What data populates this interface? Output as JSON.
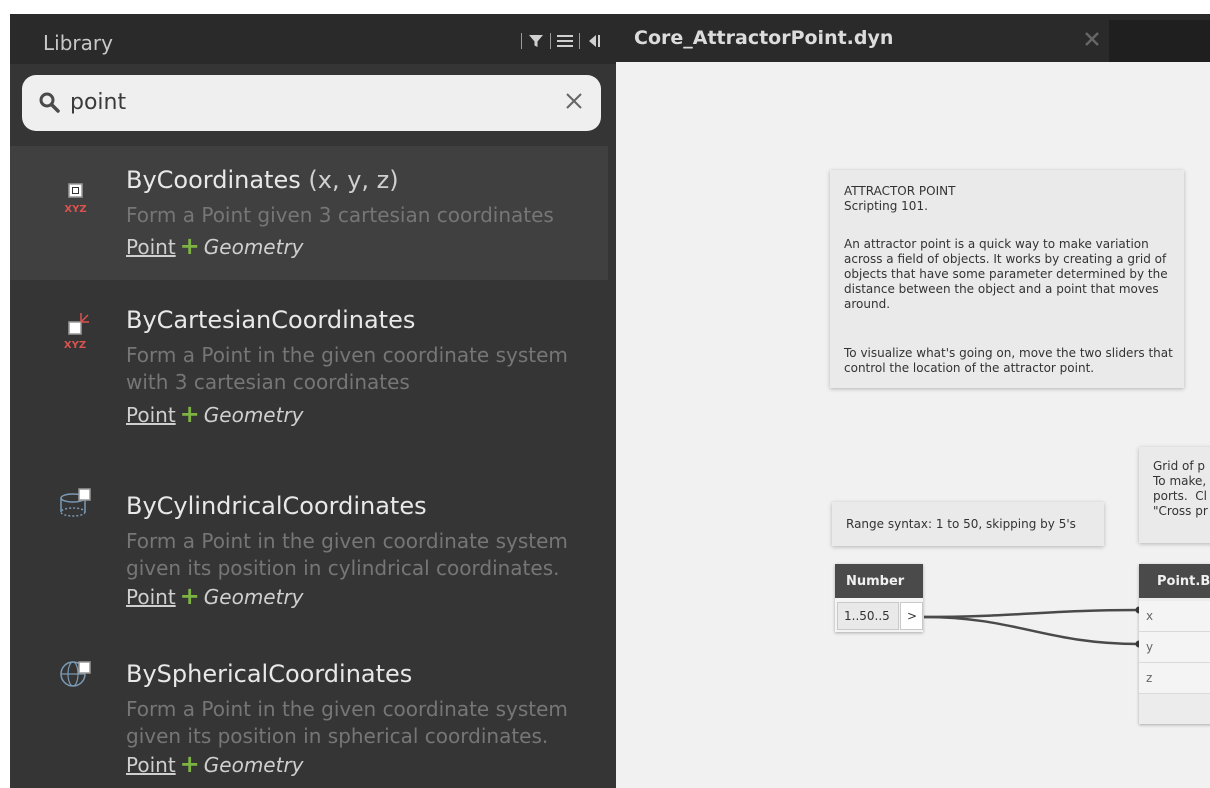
{
  "library": {
    "title": "Library",
    "search": {
      "value": "point",
      "placeholder": ""
    },
    "items": [
      {
        "name": "ByCoordinates",
        "params": " (x, y, z)",
        "description": "Form a Point given 3 cartesian coordinates",
        "category": "Point",
        "group": "Geometry",
        "icon": "point-by-coordinates-icon",
        "selected": true
      },
      {
        "name": "ByCartesianCoordinates",
        "params": "",
        "description": "Form a Point in the given coordinate system with 3 cartesian coordinates",
        "category": "Point",
        "group": "Geometry",
        "icon": "point-by-cartesian-coordinates-icon"
      },
      {
        "name": "ByCylindricalCoordinates",
        "params": "",
        "description": "Form a Point in the given coordinate system given its position in cylindrical coordinates.",
        "category": "Point",
        "group": "Geometry",
        "icon": "point-by-cylindrical-coordinates-icon"
      },
      {
        "name": "BySphericalCoordinates",
        "params": "",
        "description": "Form a Point in the given coordinate system given its position in spherical coordinates.",
        "category": "Point",
        "group": "Geometry",
        "icon": "point-by-spherical-coordinates-icon"
      }
    ]
  },
  "tab": {
    "title": "Core_AttractorPoint.dyn"
  },
  "canvas": {
    "note1": {
      "title": "ATTRACTOR POINT",
      "subtitle": "Scripting 101.",
      "para1": "An attractor point is a quick way to make variation across a field of objects.  It works by creating a grid of objects that have some parameter determined by the distance between the object and a point that moves around.",
      "para2": "To visualize what's going on, move the two sliders that control the location of the attractor point."
    },
    "note2": "Range syntax: 1 to 50, skipping by 5's",
    "note3": "Grid of p\nTo make,\nports.  Cl\n\"Cross pr",
    "number_node": {
      "title": "Number",
      "value": "1..50..5",
      "output": ">"
    },
    "point_node": {
      "title": "Point.B",
      "ports": [
        "x",
        "y",
        "z"
      ]
    }
  },
  "colors": {
    "accent_green": "#7cb342",
    "panel_bg": "#353535",
    "icon_red": "#d9534f"
  }
}
